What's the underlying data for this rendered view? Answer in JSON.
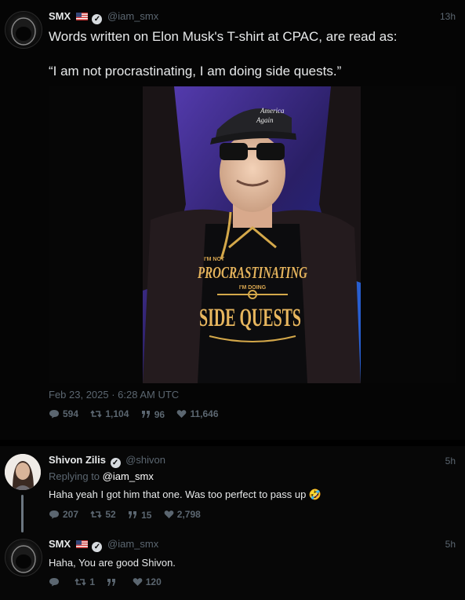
{
  "main_tweet": {
    "name": "SMX",
    "handle": "@iam_smx",
    "time": "13h",
    "text_line1": "Words written on Elon Musk's T-shirt at CPAC, are read as:",
    "text_line2": "“I am not procrastinating, I am doing side quests.”",
    "image": {
      "hat_text_1": "America",
      "hat_text_2": "Again",
      "shirt_small_1": "I'M NOT",
      "shirt_big_1": "PROCRASTINATING",
      "shirt_small_2": "I'M DOING",
      "shirt_big_2": "SIDE QUESTS"
    },
    "date": "Feb 23, 2025 · 6:28 AM UTC",
    "replies": "594",
    "retweets": "1,104",
    "quotes": "96",
    "likes": "11,646"
  },
  "reply_1": {
    "name": "Shivon Zilis",
    "handle": "@shivon",
    "time": "5h",
    "replying_prefix": "Replying to",
    "replying_to": "@iam_smx",
    "text": "Haha yeah I got him that one. Was too perfect to pass up 🤣",
    "replies": "207",
    "retweets": "52",
    "quotes": "15",
    "likes": "2,798"
  },
  "reply_2": {
    "name": "SMX",
    "handle": "@iam_smx",
    "time": "5h",
    "text": "Haha, You are good Shivon.",
    "replies": "",
    "retweets": "1",
    "quotes": "",
    "likes": "120"
  },
  "colors": {
    "background": "#000000",
    "card": "#0a0a0a",
    "muted": "#5b6670",
    "text": "#e7e9ea",
    "link": "#ffffff"
  }
}
